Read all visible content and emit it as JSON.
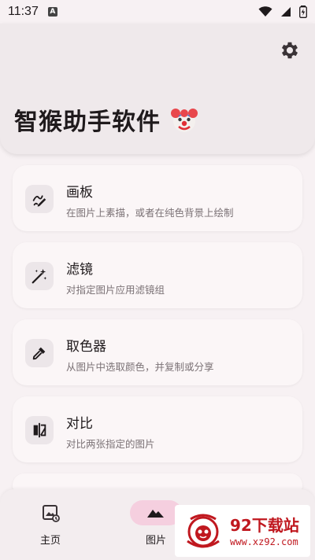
{
  "status_bar": {
    "time": "11:37",
    "notification_icon": "a-icon"
  },
  "header": {
    "title": "智猴助手软件",
    "emoji_icon": "clown-face-icon",
    "settings_icon": "gear-icon"
  },
  "cards": [
    {
      "title": "画板",
      "subtitle": "在图片上素描，或者在纯色背景上绘制",
      "icon": "pen-draw-icon"
    },
    {
      "title": "滤镜",
      "subtitle": "对指定图片应用滤镜组",
      "icon": "magic-wand-icon"
    },
    {
      "title": "取色器",
      "subtitle": "从图片中选取颜色，并复制或分享",
      "icon": "eyedropper-icon"
    },
    {
      "title": "对比",
      "subtitle": "对比两张指定的图片",
      "icon": "compare-icon"
    }
  ],
  "bottom_nav": {
    "items": [
      {
        "label": "主页",
        "icon": "image-home-icon",
        "active": false
      },
      {
        "label": "图片",
        "icon": "landscape-icon",
        "active": true
      }
    ]
  },
  "watermark": {
    "title": "92下载站",
    "url": "www.xz92.com"
  },
  "colors": {
    "background": "#f7f1f3",
    "card": "#fbf6f7",
    "active_pill": "#f5cfdf",
    "watermark_red": "#c0181f"
  }
}
